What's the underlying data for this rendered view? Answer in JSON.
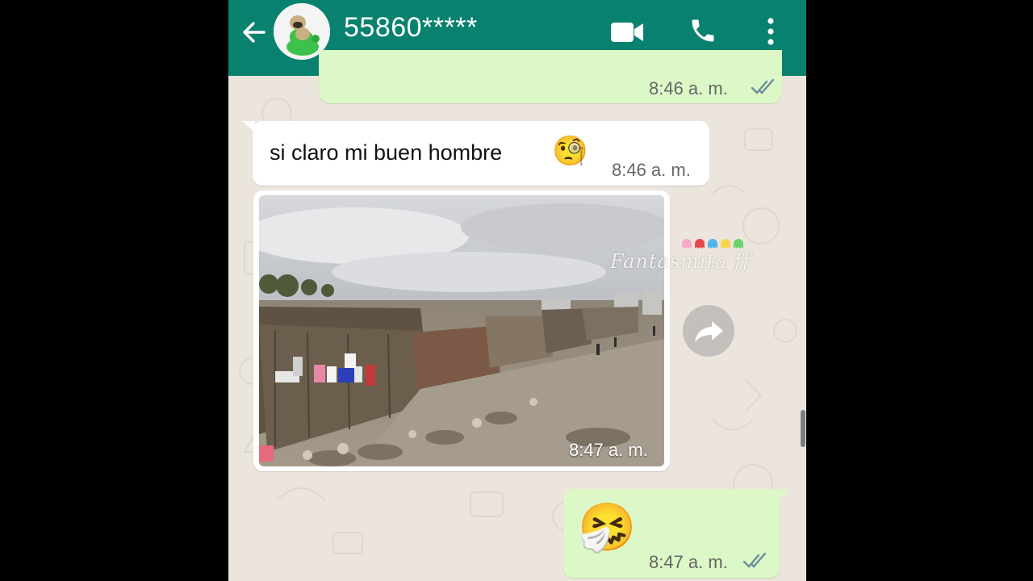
{
  "header": {
    "contact_name": "55860*****",
    "back_icon": "arrow-left-icon",
    "video_icon": "video-camera-icon",
    "call_icon": "phone-icon",
    "menu_icon": "more-vert-icon",
    "color": "#08826E"
  },
  "messages": [
    {
      "direction": "outgoing",
      "time": "8:46 a. m.",
      "status": "read"
    },
    {
      "direction": "incoming",
      "text": "si claro mi buen hombre",
      "emoji": "🧐",
      "time": "8:46 a. m."
    },
    {
      "direction": "incoming",
      "type": "image",
      "time": "8:47 a. m."
    },
    {
      "direction": "outgoing",
      "emoji": "🤧",
      "time": "8:47 a. m.",
      "status": "read"
    }
  ],
  "watermark": "Fantasmita ff",
  "colors": {
    "chat_bg": "#ECE5DD",
    "outgoing": "#DCF8C6",
    "incoming": "#FFFFFF",
    "tick": "#6C8C9C"
  }
}
